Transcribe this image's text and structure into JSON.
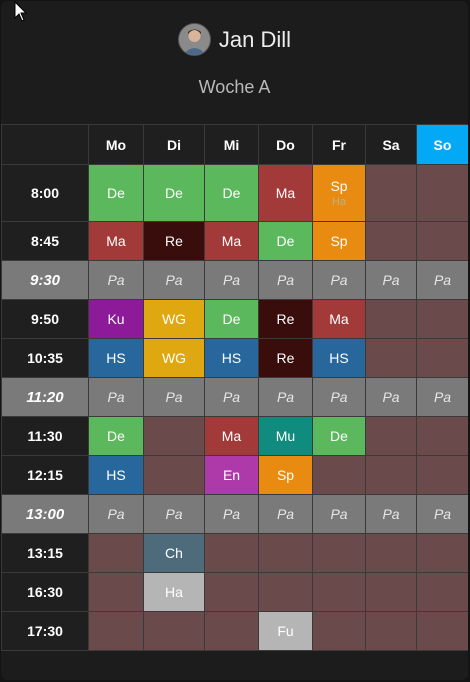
{
  "header": {
    "name": "Jan Dill",
    "week": "Woche A"
  },
  "colors": {
    "De": "#5cb85c",
    "Ma": "#a33a3a",
    "Sp": "#e88b10",
    "Re": "#3a0d0d",
    "Ku": "#8c1a99",
    "WG": "#e0a810",
    "HS": "#27679c",
    "Mu": "#0f8c7e",
    "En": "#ad3aa8",
    "Ch": "#4d6b7a",
    "Ha": "#b5b5b5",
    "Fu": "#b5b5b5",
    "empty": "#6a4a4a",
    "pause": "#7a7a7a",
    "today": "#03a9f4"
  },
  "days": [
    "Mo",
    "Di",
    "Mi",
    "Do",
    "Fr",
    "Sa",
    "So"
  ],
  "today_index": 6,
  "rows": [
    {
      "type": "lesson",
      "time": "8:00",
      "tall": true,
      "cells": [
        {
          "s": "De"
        },
        {
          "s": "De"
        },
        {
          "s": "De"
        },
        {
          "s": "Ma"
        },
        {
          "s": "Sp",
          "sub": "Ha"
        },
        null,
        null
      ]
    },
    {
      "type": "lesson",
      "time": "8:45",
      "cells": [
        {
          "s": "Ma"
        },
        {
          "s": "Re"
        },
        {
          "s": "Ma"
        },
        {
          "s": "De"
        },
        {
          "s": "Sp"
        },
        null,
        null
      ]
    },
    {
      "type": "pause",
      "time": "9:30",
      "label": "Pa"
    },
    {
      "type": "lesson",
      "time": "9:50",
      "cells": [
        {
          "s": "Ku"
        },
        {
          "s": "WG"
        },
        {
          "s": "De"
        },
        {
          "s": "Re"
        },
        {
          "s": "Ma"
        },
        null,
        null
      ]
    },
    {
      "type": "lesson",
      "time": "10:35",
      "cells": [
        {
          "s": "HS"
        },
        {
          "s": "WG"
        },
        {
          "s": "HS"
        },
        {
          "s": "Re"
        },
        {
          "s": "HS"
        },
        null,
        null
      ]
    },
    {
      "type": "pause",
      "time": "11:20",
      "label": "Pa"
    },
    {
      "type": "lesson",
      "time": "11:30",
      "cells": [
        {
          "s": "De"
        },
        null,
        {
          "s": "Ma"
        },
        {
          "s": "Mu"
        },
        {
          "s": "De"
        },
        null,
        null
      ]
    },
    {
      "type": "lesson",
      "time": "12:15",
      "cells": [
        {
          "s": "HS"
        },
        null,
        {
          "s": "En"
        },
        {
          "s": "Sp"
        },
        null,
        null,
        null
      ]
    },
    {
      "type": "pause",
      "time": "13:00",
      "label": "Pa"
    },
    {
      "type": "lesson",
      "time": "13:15",
      "cells": [
        null,
        {
          "s": "Ch"
        },
        null,
        null,
        null,
        null,
        null
      ]
    },
    {
      "type": "lesson",
      "time": "16:30",
      "cells": [
        null,
        {
          "s": "Ha"
        },
        null,
        null,
        null,
        null,
        null
      ]
    },
    {
      "type": "lesson",
      "time": "17:30",
      "cells": [
        null,
        null,
        null,
        {
          "s": "Fu"
        },
        null,
        null,
        null
      ]
    }
  ]
}
